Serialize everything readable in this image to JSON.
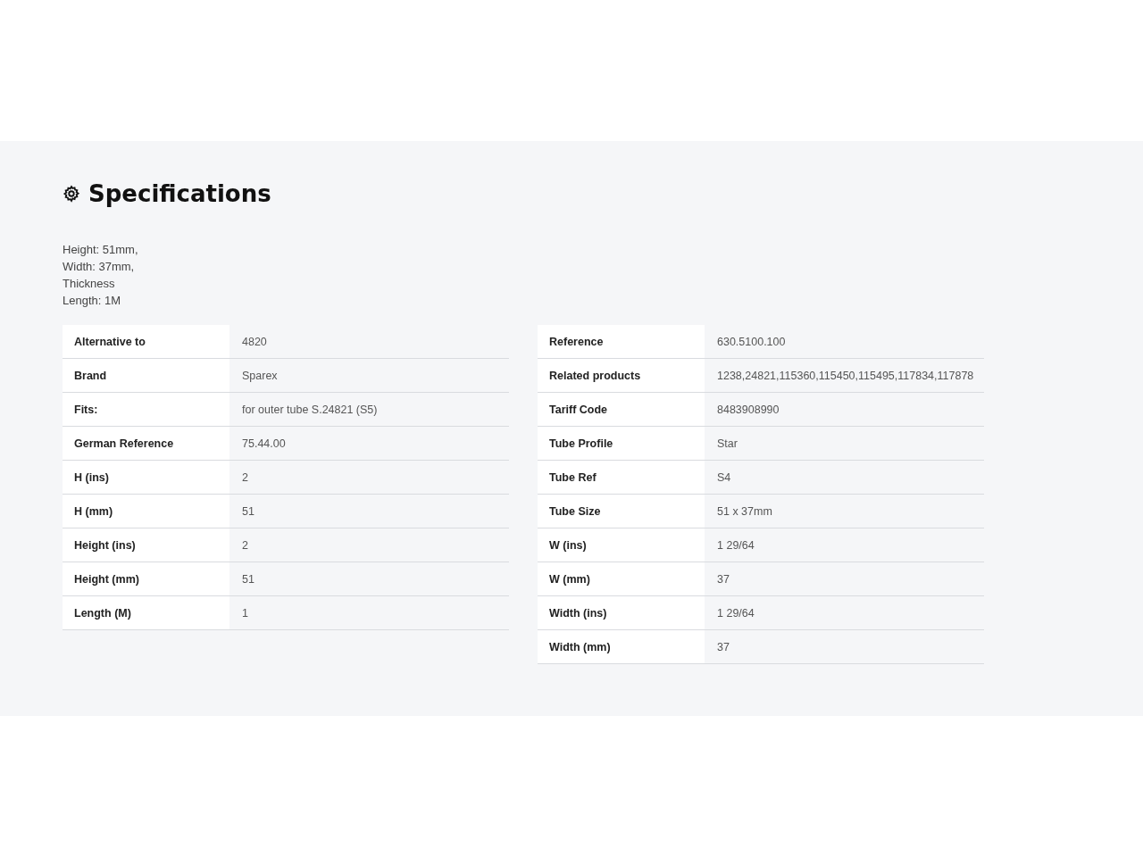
{
  "section": {
    "title": "Specifications",
    "description": [
      "Height: 51mm,",
      "Width: 37mm,",
      "Thickness",
      "Length: 1M"
    ],
    "tables": [
      {
        "rows": [
          {
            "label": "Alternative to",
            "value": "4820"
          },
          {
            "label": "Brand",
            "value": "Sparex"
          },
          {
            "label": "Fits:",
            "value": "for outer tube S.24821 (S5)"
          },
          {
            "label": "German Reference",
            "value": "75.44.00"
          },
          {
            "label": "H (ins)",
            "value": "2"
          },
          {
            "label": "H (mm)",
            "value": "51"
          },
          {
            "label": "Height (ins)",
            "value": "2"
          },
          {
            "label": "Height (mm)",
            "value": "51"
          },
          {
            "label": "Length (M)",
            "value": "1"
          }
        ]
      },
      {
        "rows": [
          {
            "label": "Reference",
            "value": "630.5100.100"
          },
          {
            "label": "Related products",
            "value": "1238,24821,115360,115450,115495,117834,117878"
          },
          {
            "label": "Tariff Code",
            "value": "8483908990"
          },
          {
            "label": "Tube Profile",
            "value": "Star"
          },
          {
            "label": "Tube Ref",
            "value": "S4"
          },
          {
            "label": "Tube Size",
            "value": "51 x 37mm"
          },
          {
            "label": "W (ins)",
            "value": "1 29/64"
          },
          {
            "label": "W (mm)",
            "value": "37"
          },
          {
            "label": "Width (ins)",
            "value": "1 29/64"
          },
          {
            "label": "Width (mm)",
            "value": "37"
          }
        ]
      }
    ]
  }
}
